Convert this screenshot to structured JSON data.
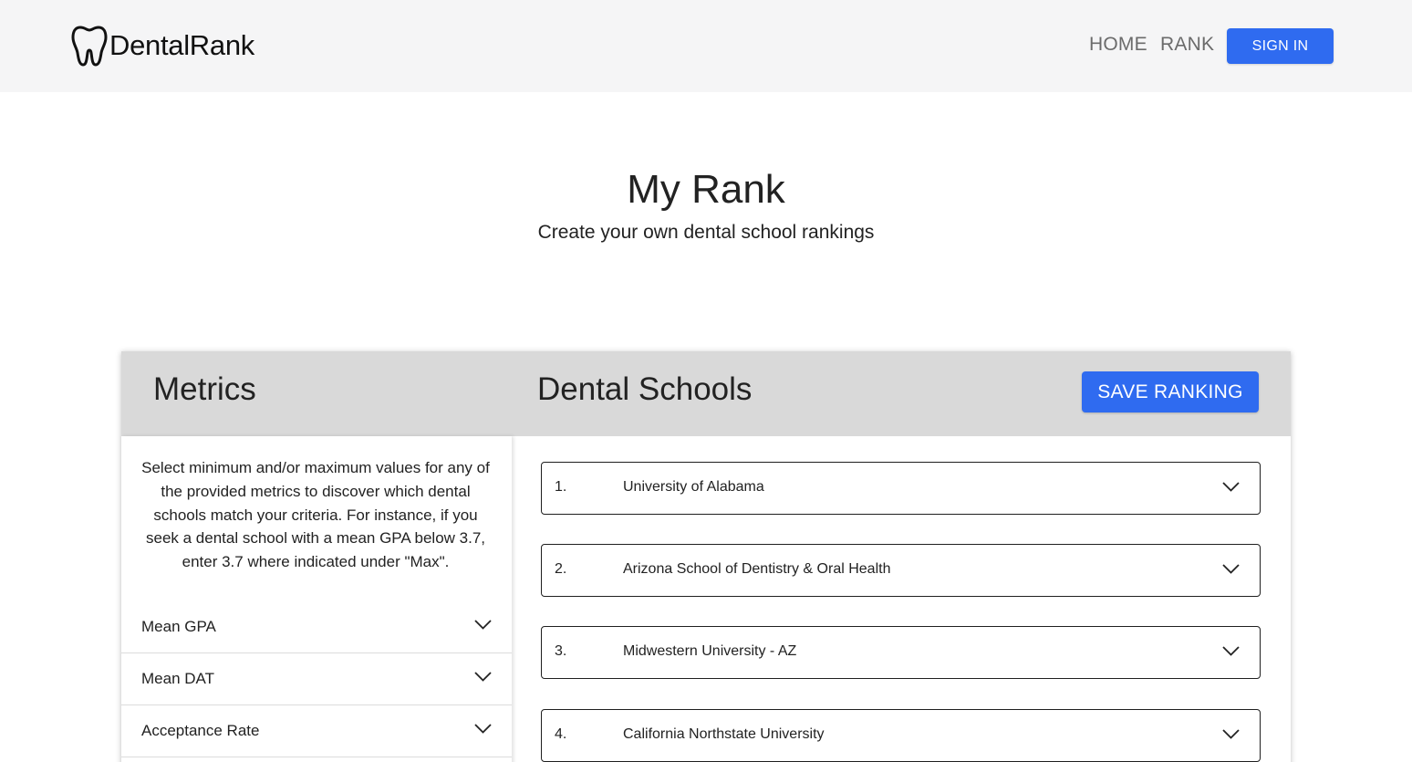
{
  "nav": {
    "logo_text": "DentalRank",
    "home_label": "HOME",
    "rank_label": "RANK",
    "signin_label": "SIGN IN"
  },
  "hero": {
    "title": "My Rank",
    "subtitle": "Create your own dental school rankings"
  },
  "panel": {
    "metrics_heading": "Metrics",
    "schools_heading": "Dental Schools",
    "save_label": "SAVE RANKING",
    "metrics_intro": "Select minimum and/or maximum values for any of the provided metrics to discover which dental schools match your criteria. For instance, if you seek a dental school with a mean GPA below 3.7, enter 3.7 where indicated under \"Max\".",
    "metrics": [
      {
        "label": "Mean GPA"
      },
      {
        "label": "Mean DAT"
      },
      {
        "label": "Acceptance Rate"
      }
    ],
    "schools": [
      {
        "rank": "1.",
        "name": "University of Alabama"
      },
      {
        "rank": "2.",
        "name": "Arizona School of Dentistry & Oral Health"
      },
      {
        "rank": "3.",
        "name": "Midwestern University - AZ"
      },
      {
        "rank": "4.",
        "name": "California Northstate University"
      }
    ]
  },
  "colors": {
    "accent": "#2f6bf0",
    "topbar_bg": "#f5f5f6",
    "panel_header_bg": "#d9d9d9"
  },
  "icons": {
    "logo": "tooth-icon",
    "expand": "chevron-down-icon"
  }
}
